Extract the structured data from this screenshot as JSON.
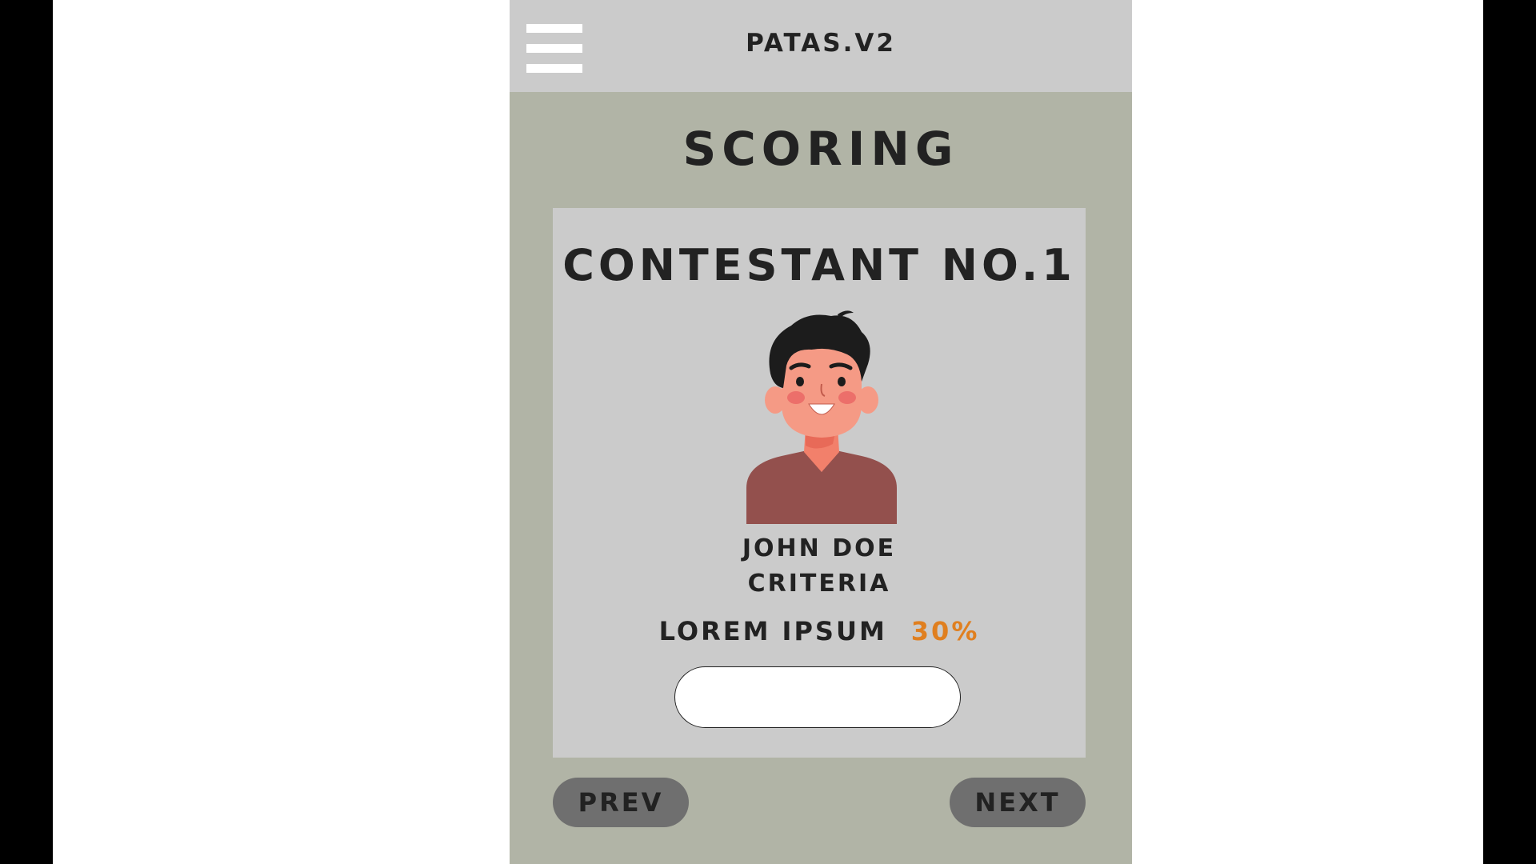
{
  "header": {
    "app_title": "PATAS.V2",
    "menu_icon": "hamburger-menu-icon"
  },
  "main": {
    "page_title": "SCORING"
  },
  "card": {
    "contestant_title": "CONTESTANT NO.1",
    "avatar": "avatar-illustration",
    "name": "JOHN DOE",
    "criteria_label": "CRITERIA",
    "criterion_name": "LOREM IPSUM",
    "criterion_weight": "30%",
    "score_input_value": ""
  },
  "navigation": {
    "prev_label": "PREV",
    "next_label": "NEXT"
  },
  "colors": {
    "header_bg": "#cbcbcb",
    "page_bg": "#b1b4a6",
    "card_bg": "#cbcbcb",
    "accent": "#e07f1f",
    "button_bg": "#6f6f6f",
    "text": "#222222"
  }
}
